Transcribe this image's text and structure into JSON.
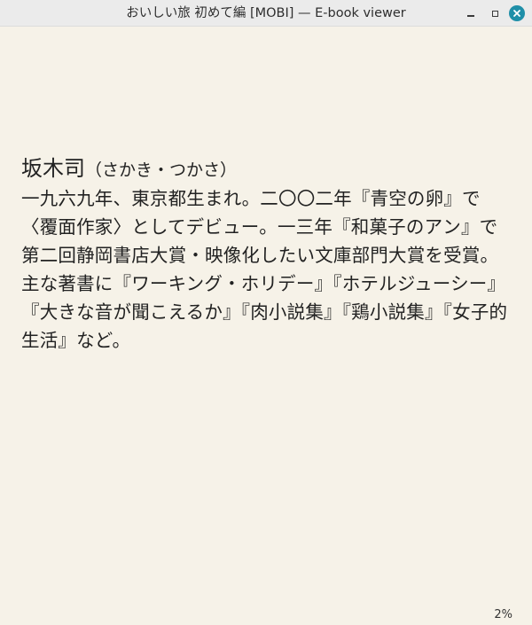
{
  "window": {
    "title": "おいしい旅 初めて編 [MOBI] — E-book viewer",
    "controls": {
      "minimize_icon": "minimize-icon",
      "maximize_icon": "maximize-icon",
      "close_icon": "close-icon",
      "close_color": "#1f8fa8"
    }
  },
  "book": {
    "author_name": "坂木司",
    "author_reading": "（さかき・つかさ）",
    "bio": "一九六九年、東京都生まれ。二〇〇二年『青空の卵』で〈覆面作家〉としてデビュー。一三年『和菓子のアン』で第二回静岡書店大賞・映像化したい文庫部門大賞を受賞。主な著書に『ワーキング・ホリデー』『ホテルジューシー』『大きな音が聞こえるか』『肉小説集』『鶏小説集』『女子的生活』など。"
  },
  "status": {
    "progress": "2%"
  },
  "colors": {
    "page_background": "#f6f2e8",
    "text": "#222222"
  }
}
